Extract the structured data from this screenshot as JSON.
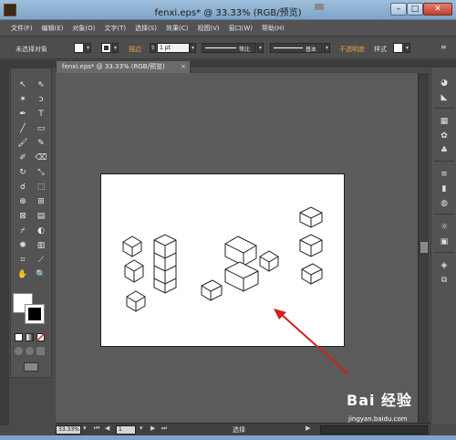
{
  "window": {
    "title": "fenxi.eps* @ 33.33% (RGB/预览)"
  },
  "menu": [
    "文件(F)",
    "编辑(E)",
    "对象(O)",
    "文字(T)",
    "选择(S)",
    "效果(C)",
    "视图(V)",
    "窗口(W)",
    "帮助(H)"
  ],
  "control": {
    "selection": "未选择对象",
    "stroke_label": "描边",
    "stroke_weight": "1 pt",
    "profile": "等比",
    "brush": "基本",
    "opacity_label": "不透明度",
    "style_label": "样式"
  },
  "colors": {
    "stroke_label": "#e8a23c",
    "opacity_label": "#e8a23c",
    "arrow": "#d0201f"
  },
  "document": {
    "tab_label": "fenxi.eps* @ 33.33% (RGB/预览)",
    "close_glyph": "×"
  },
  "status": {
    "zoom": "33.33%",
    "page": "1",
    "mode": "选择"
  },
  "watermark": {
    "logo": "Bai 经验",
    "url": "jingyan.baidu.com"
  }
}
